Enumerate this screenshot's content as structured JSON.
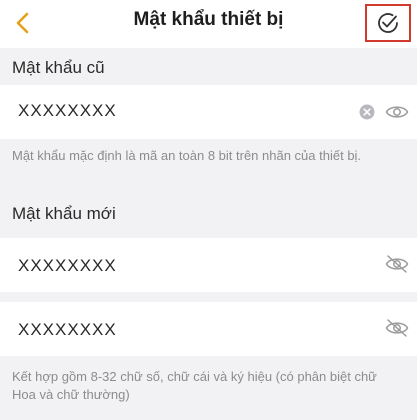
{
  "header": {
    "title": "Mật khẩu thiết bị",
    "back_icon": "chevron-left-icon",
    "confirm_icon": "check-circle-icon",
    "accent_color": "#e0a21a",
    "highlight_color": "#d43a2c"
  },
  "old_password": {
    "label": "Mật khẩu cũ",
    "value": "XXXXXXXX",
    "hint": "Mật khẩu mặc định là mã an toàn 8 bit trên nhãn của thiết bị."
  },
  "new_password": {
    "label": "Mật khẩu mới",
    "value": "XXXXXXXX",
    "confirm_value": "XXXXXXXX",
    "hint": "Kết hợp gồm 8-32 chữ số, chữ cái và ký hiệu (có phân biệt chữ Hoa và chữ thường)"
  }
}
